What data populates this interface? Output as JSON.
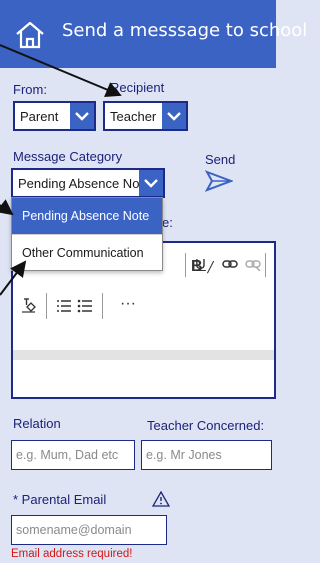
{
  "header": {
    "title": "Send a messsage to school"
  },
  "form": {
    "from_label": "From:",
    "from_value": "Parent",
    "recipient_label": "Recipient",
    "recipient_value": "Teacher",
    "category_label": "Message Category",
    "category_value": "Pending Absence Note",
    "send_label": "Send",
    "category_options": [
      "Pending Absence Note",
      "Other Communication"
    ],
    "peek_label_fragment": "e:"
  },
  "toolbar": {
    "more_label": "···"
  },
  "relation": {
    "label": "Relation",
    "placeholder": "e.g. Mum, Dad etc"
  },
  "teacher": {
    "label": "Teacher Concerned:",
    "placeholder": "e.g. Mr Jones"
  },
  "email": {
    "label": "* Parental Email",
    "placeholder": "somename@domain",
    "error": "Email address required!"
  },
  "colors": {
    "accent": "#3b63c4",
    "background": "#dfe4f4",
    "text": "#1c227a",
    "error": "#d01818"
  },
  "icons": [
    "home-icon",
    "chevron-down-icon",
    "send-icon",
    "bold-icon",
    "italic-icon",
    "underline-icon",
    "link-icon",
    "unlink-icon",
    "clear-format-icon",
    "numbered-list-icon",
    "bulleted-list-icon",
    "more-icon",
    "warning-icon"
  ]
}
